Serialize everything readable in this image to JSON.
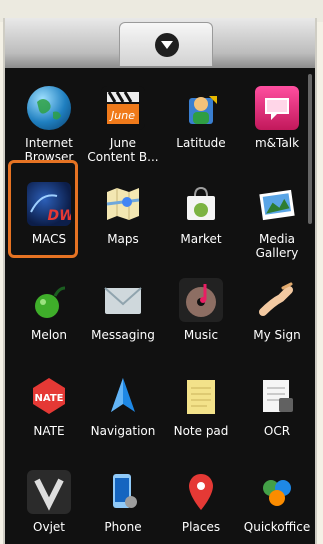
{
  "apps": [
    {
      "label": "Internet Browser",
      "icon": "globe-icon"
    },
    {
      "label": "June Content B...",
      "icon": "film-clapper-icon"
    },
    {
      "label": "Latitude",
      "icon": "person-location-icon"
    },
    {
      "label": "m&Talk",
      "icon": "chat-bubble-icon"
    },
    {
      "label": "MACS",
      "icon": "macs-dw-icon"
    },
    {
      "label": "Maps",
      "icon": "map-icon"
    },
    {
      "label": "Market",
      "icon": "shopping-bag-icon"
    },
    {
      "label": "Media Gallery",
      "icon": "photo-gallery-icon"
    },
    {
      "label": "Melon",
      "icon": "melon-icon"
    },
    {
      "label": "Messaging",
      "icon": "envelope-icon"
    },
    {
      "label": "Music",
      "icon": "music-disc-icon"
    },
    {
      "label": "My Sign",
      "icon": "hand-sign-icon"
    },
    {
      "label": "NATE",
      "icon": "nate-icon"
    },
    {
      "label": "Navigation",
      "icon": "navigation-arrow-icon"
    },
    {
      "label": "Note pad",
      "icon": "notepad-icon"
    },
    {
      "label": "OCR",
      "icon": "ocr-document-icon"
    },
    {
      "label": "Ovjet",
      "icon": "ovjet-icon"
    },
    {
      "label": "Phone",
      "icon": "phone-gear-icon"
    },
    {
      "label": "Places",
      "icon": "map-pin-icon"
    },
    {
      "label": "Quickoffice",
      "icon": "quickoffice-icon"
    }
  ],
  "highlighted_app": "MACS",
  "colors": {
    "highlight": "#e67323",
    "drawer_bg": "#111111"
  }
}
